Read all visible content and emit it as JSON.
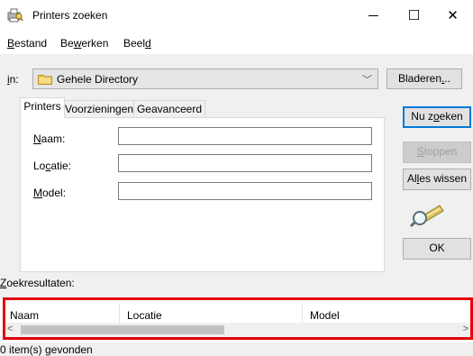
{
  "window": {
    "title": "Printers zoeken",
    "controls": {
      "minimize": "─",
      "maximize": "☐",
      "close": "✕"
    },
    "icon": "printer-search-icon"
  },
  "menu": [
    {
      "label": "Bestand",
      "mnemonic": "B",
      "rest": "estand"
    },
    {
      "label": "Bewerken",
      "pre": "Be",
      "mnemonic": "w",
      "rest": "erken"
    },
    {
      "label": "Beeld",
      "pre": "Beel",
      "mnemonic": "d"
    }
  ],
  "scope": {
    "label_mnemonic": "i",
    "label_rest": "n:",
    "value": "Gehele Directory",
    "icon": "folder-icon",
    "arrow": "﹀"
  },
  "browse_button": {
    "pre": "Bladeren",
    "mnemonic": ".",
    "rest": ".."
  },
  "tabs": [
    {
      "label": "Printers",
      "active": true
    },
    {
      "label": "Voorzieningen",
      "active": false
    },
    {
      "label": "Geavanceerd",
      "active": false
    }
  ],
  "fields": {
    "name": {
      "mnemonic": "N",
      "rest": "aam:",
      "value": ""
    },
    "location": {
      "pre": "Lo",
      "mnemonic": "c",
      "rest": "atie:",
      "value": ""
    },
    "model": {
      "mnemonic": "M",
      "rest": "odel:",
      "value": ""
    }
  },
  "buttons": {
    "search": {
      "pre": "Nu z",
      "mnemonic": "o",
      "rest": "eken"
    },
    "stop": {
      "mnemonic": "S",
      "rest": "toppen"
    },
    "clear": {
      "pre": "Al",
      "mnemonic": "l",
      "rest": "es wissen"
    },
    "ok": "OK"
  },
  "results": {
    "label_mnemonic": "Z",
    "label_rest": "oekresultaten:",
    "columns": [
      "Naam",
      "Locatie",
      "Model"
    ],
    "scroll_left": "<",
    "scroll_right": ">"
  },
  "status": "0 item(s) gevonden",
  "colors": {
    "highlight_border": "#e3000b",
    "default_button_border": "#0078d7"
  }
}
